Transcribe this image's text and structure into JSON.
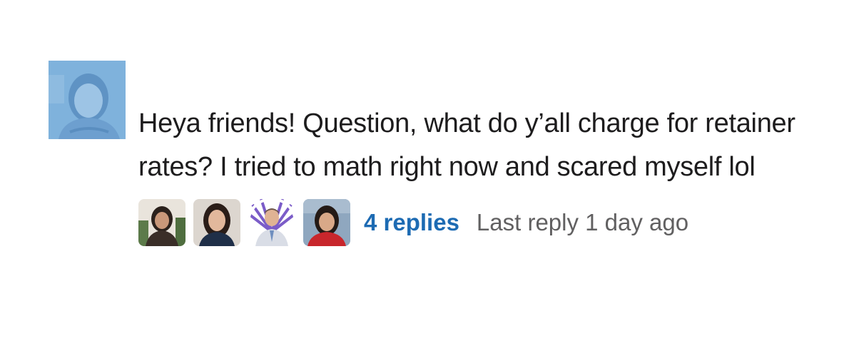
{
  "message": {
    "author_avatar_icon": "user-avatar-icon",
    "text": "Heya friends! Question, what do y’all charge for retainer rates? I tried to math right now and scared myself lol",
    "thread": {
      "participant_avatars": [
        "participant-avatar-icon",
        "participant-avatar-icon",
        "participant-avatar-icon",
        "participant-avatar-icon"
      ],
      "replies_label": "4 replies",
      "last_reply_label": "Last reply 1 day ago"
    }
  },
  "colors": {
    "link": "#1d6bb3",
    "text": "#1d1c1d",
    "muted": "#616061",
    "author_avatar_bg": "#7fb2dc"
  }
}
